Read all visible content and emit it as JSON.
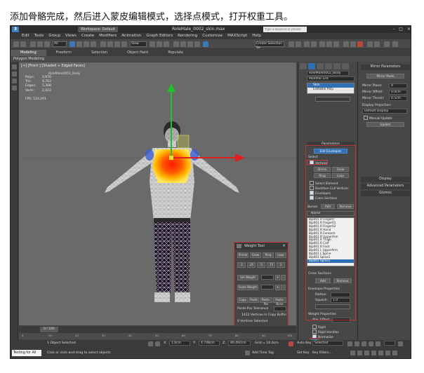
{
  "caption": "添加骨骼完成，然后进入蒙皮编辑模式，选择点模式，打开权重工具。",
  "titlebar": {
    "workspace": "Workspace: Default",
    "title": "RoleMale_0002_skin.max",
    "search_placeholder": "Type a keyword or phrase"
  },
  "menu": [
    "Edit",
    "Tools",
    "Group",
    "Views",
    "Create",
    "Modifiers",
    "Animation",
    "Graph Editors",
    "Rendering",
    "Customize",
    "MAXScript",
    "Help"
  ],
  "toolbar": {
    "view_dropdown": "View",
    "selection_set": "Create Selection Se"
  },
  "ribbon": {
    "tabs": [
      "Modeling",
      "Freeform",
      "Selection",
      "Object Paint",
      "Populate"
    ],
    "active_tab": "Modeling",
    "sub_label": "Polygon Modeling"
  },
  "viewport": {
    "label": "[+] [Front ] [Shaded + Edged Faces]",
    "object_name": "RoleMale0002_Body",
    "stats": [
      {
        "k": "Polys:",
        "v": "2,976"
      },
      {
        "k": "Tris:",
        "v": "4,763"
      },
      {
        "k": "Edges:",
        "v": "5,308"
      },
      {
        "k": "Verts:",
        "v": "2,423"
      }
    ],
    "fps_label": "FPS:",
    "fps_value": "123.291"
  },
  "weight_tool": {
    "title": "Weight Tool",
    "row1": [
      "Shrink",
      "Grow",
      "Ring",
      "Loop"
    ],
    "row2": [
      ".1",
      ".25",
      ".5",
      ".75",
      "1"
    ],
    "set_weight": "Set Weight",
    "scale_weight": "Scale Weight",
    "row3": [
      "Copy",
      "Paste",
      "Paste-Pos",
      "Paste-Bone"
    ],
    "paste_tolerance": "Paste-Pos Tolerance",
    "buffer_text": "1422 Vertices In Copy Buffer",
    "selected_text": "0 Vertices Selected"
  },
  "command_panel": {
    "object_name": "RoleMale0002_Body",
    "modifier_list": "Modifier List",
    "stack": [
      "Skin",
      "Editable Poly"
    ],
    "stack_selected": "Skin",
    "parameters_head": "Parameters",
    "edit_envelopes": "Edit Envelopes",
    "select_label": "Select",
    "vertices": "Vertices",
    "shrink": "Shrink",
    "grow": "Grow",
    "ring": "Ring",
    "loop": "Loop",
    "select_element": "Select Element",
    "backface_cull": "Backface Cull Vertices",
    "envelopes": "Envelopes",
    "cross_sections": "Cross Sections",
    "bones_label": "Bones:",
    "add": "Add",
    "remove": "Remove",
    "name_label": "Name",
    "bones": [
      "Bip001 R Finger0",
      "Bip001 R Finger01",
      "Bip001 R Finger02",
      "Bip001 R Hand",
      "Bip001 R Forearm",
      "Bip001 R UpperArm",
      "Bip001 R Thigh",
      "Bip001 R Calf",
      "Bip001 R Foot",
      "Bip001 L UpperArm",
      "Bip001 L Spine",
      "Bip001 Spine1",
      "Bip001 Spine2"
    ],
    "selected_bone": "Bip001 Spine2",
    "cross_sections_head": "Cross Sections",
    "envelope_props": "Envelope Properties",
    "radius_label": "Radius:",
    "radius_value": "",
    "squash_label": "Squash:",
    "squash_value": "1.0",
    "weight_props": "Weight Properties",
    "abs_effect": "Abs. Effect:",
    "abs_value": "",
    "rigid": "Rigid",
    "rigid_handles": "Rigid Handles",
    "normalize": "Normalize",
    "weight_table": "Weight Table"
  },
  "right_panel": {
    "mirror_params": "Mirror Parameters",
    "mirror_mode": "Mirror Mode",
    "mirror_plane": "Mirror Plane:",
    "mirror_plane_value": "X",
    "mirror_offset": "Mirror Offset:",
    "mirror_offset_value": "0.0cm",
    "mirror_thresh": "Mirror Thresh:",
    "mirror_thresh_value": "0.5cm",
    "display_projection": "Display Projection:",
    "default_display": "Default Display",
    "manual_update": "Manual Update",
    "update": "Update",
    "display": "Display",
    "advanced": "Advanced Parameters",
    "gizmos": "Gizmos"
  },
  "timeline": {
    "frame": "0 / 100",
    "ticks": [
      "0",
      "10",
      "20",
      "30",
      "40",
      "50",
      "60",
      "70",
      "80",
      "90",
      "100"
    ]
  },
  "status": {
    "maxscript": "Testing for All",
    "selected": "1 Object Selected",
    "hint": "Click or click-and-drag to select objects",
    "x_label": "X:",
    "x_value": "1.0cm",
    "y_label": "Y:",
    "y_value": "4.748cm",
    "z_label": "Z:",
    "z_value": "80.492cm",
    "grid": "Grid = 10.0cm",
    "add_time_tag": "Add Time Tag",
    "auto_key": "Auto Key",
    "selected_dd": "Selected",
    "set_key": "Set Key",
    "key_filters": "Key Filters..."
  }
}
